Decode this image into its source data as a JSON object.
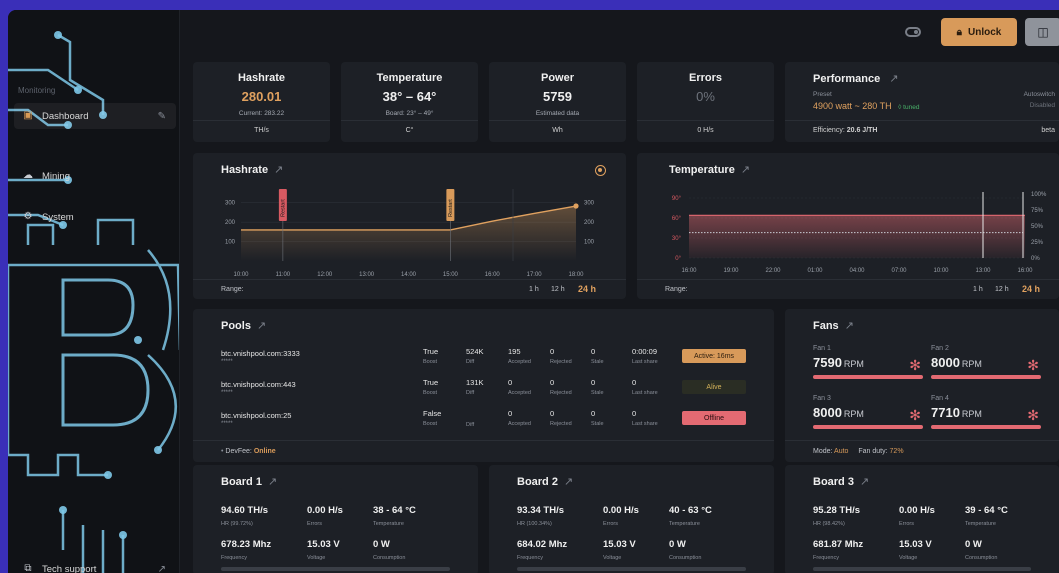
{
  "sidebar": {
    "section_monitoring": "Monitoring",
    "items": [
      {
        "label": "Dashboard",
        "icon": "chart-icon"
      },
      {
        "label": "Mining",
        "icon": "cloud-icon"
      },
      {
        "label": "System",
        "icon": "gear-icon"
      }
    ],
    "bottom_item": "Tech support"
  },
  "topbar": {
    "unlock_label": "Unlock"
  },
  "stats": {
    "hashrate": {
      "title": "Hashrate",
      "value": "280.01",
      "sub": "Current: 283.22",
      "unit": "TH/s"
    },
    "temperature": {
      "title": "Temperature",
      "value": "38° – 64°",
      "sub": "Board: 23° – 49°",
      "unit": "C°"
    },
    "power": {
      "title": "Power",
      "value": "5759",
      "sub": "Estimated data",
      "unit": "Wh"
    },
    "errors": {
      "title": "Errors",
      "value": "0%",
      "unit": "0 H/s"
    },
    "performance": {
      "title": "Performance",
      "preset_label": "Preset",
      "preset_value": "4900 watt ~ 280 TH",
      "tuned": "◊ tuned",
      "autoswitch_label": "Autoswitch",
      "autoswitch_value": "Disabled",
      "efficiency_label": "Efficiency:",
      "efficiency_value": "20.6 J/TH",
      "beta": "beta"
    }
  },
  "hashrate_chart": {
    "title": "Hashrate",
    "range_label": "Range:",
    "ranges": [
      "1 h",
      "12 h",
      "24 h"
    ],
    "selected_range": "24 h",
    "markers": [
      "Restart",
      "Restart"
    ]
  },
  "temperature_chart": {
    "title": "Temperature",
    "range_label": "Range:",
    "ranges": [
      "1 h",
      "12 h",
      "24 h"
    ],
    "selected_range": "24 h"
  },
  "chart_data": [
    {
      "type": "line",
      "title": "Hashrate",
      "x": [
        "10:00",
        "11:00",
        "12:00",
        "13:00",
        "14:00",
        "15:00",
        "16:00",
        "17:00",
        "18:00"
      ],
      "yticks": [
        "100",
        "200",
        "300"
      ],
      "ylim": [
        0,
        350
      ],
      "series": [
        {
          "values": [
            160,
            160,
            160,
            160,
            160,
            160,
            205,
            245,
            283
          ]
        }
      ],
      "accent": "#e0a15f"
    },
    {
      "type": "line",
      "title": "Temperature",
      "x": [
        "16:00",
        "19:00",
        "22:00",
        "01:00",
        "04:00",
        "07:00",
        "10:00",
        "13:00",
        "16:00"
      ],
      "yticks_left": [
        "0°",
        "30°",
        "60°",
        "90°"
      ],
      "yticks_right": [
        "0%",
        "25%",
        "50%",
        "75%",
        "100%"
      ],
      "ylim": [
        0,
        90
      ],
      "series": [
        {
          "values": [
            64,
            64,
            64,
            64,
            64,
            64,
            64,
            64,
            64
          ],
          "color": "#e36a72"
        },
        {
          "values": [
            38,
            38,
            38,
            38,
            38,
            38,
            38,
            38,
            38
          ],
          "color": "#c9ccd2"
        }
      ]
    }
  ],
  "pools": {
    "title": "Pools",
    "cols": {
      "boost": "Boost",
      "diff": "Diff",
      "accepted": "Accepted",
      "rejected": "Rejected",
      "stale": "Stale",
      "last_share": "Last share"
    },
    "rows": [
      {
        "url": "btc.vnishpool.com:3333",
        "stars": "*****",
        "boost": "True",
        "diff": "524K",
        "accepted": "195",
        "rejected": "0",
        "stale": "0",
        "last_share": "0:00:09",
        "status": "Active: 16ms",
        "status_color": "#d89a5a",
        "status_text_color": "#2a1c0e"
      },
      {
        "url": "btc.vnishpool.com:443",
        "stars": "*****",
        "boost": "True",
        "diff": "131K",
        "accepted": "0",
        "rejected": "0",
        "stale": "0",
        "last_share": "0",
        "status": "Alive",
        "status_color": "#2a2d24",
        "status_text_color": "#d4b25a"
      },
      {
        "url": "btc.vnishpool.com:25",
        "stars": "*****",
        "boost": "False",
        "diff": "",
        "accepted": "0",
        "rejected": "0",
        "stale": "0",
        "last_share": "0",
        "status": "Offline",
        "status_color": "#e36a72",
        "status_text_color": "#2a0d10"
      }
    ],
    "devfee_label": "DevFee:",
    "devfee_value": "Online"
  },
  "fans": {
    "title": "Fans",
    "unit": "RPM",
    "items": [
      {
        "label": "Fan 1",
        "value": "7590"
      },
      {
        "label": "Fan 2",
        "value": "8000"
      },
      {
        "label": "Fan 3",
        "value": "8000"
      },
      {
        "label": "Fan 4",
        "value": "7710"
      }
    ],
    "mode_label": "Mode:",
    "mode_value": "Auto",
    "duty_label": "Fan duty:",
    "duty_value": "72%"
  },
  "boards": [
    {
      "title": "Board 1",
      "hr": "94.60 TH/s",
      "hr_label": "HR (99.72%)",
      "errors": "0.00 H/s",
      "errors_label": "Errors",
      "temp": "38 - 64 °C",
      "temp_label": "Temperature",
      "freq": "678.23 Mhz",
      "freq_label": "Frequency",
      "volt": "15.03 V",
      "volt_label": "Voltage",
      "cons": "0 W",
      "cons_label": "Consumption"
    },
    {
      "title": "Board 2",
      "hr": "93.34 TH/s",
      "hr_label": "HR (100.34%)",
      "errors": "0.00 H/s",
      "errors_label": "Errors",
      "temp": "40 - 63 °C",
      "temp_label": "Temperature",
      "freq": "684.02 Mhz",
      "freq_label": "Frequency",
      "volt": "15.03 V",
      "volt_label": "Voltage",
      "cons": "0 W",
      "cons_label": "Consumption"
    },
    {
      "title": "Board 3",
      "hr": "95.28 TH/s",
      "hr_label": "HR (98.42%)",
      "errors": "0.00 H/s",
      "errors_label": "Errors",
      "temp": "39 - 64 °C",
      "temp_label": "Temperature",
      "freq": "681.87 Mhz",
      "freq_label": "Frequency",
      "volt": "15.03 V",
      "volt_label": "Voltage",
      "cons": "0 W",
      "cons_label": "Consumption"
    }
  ]
}
